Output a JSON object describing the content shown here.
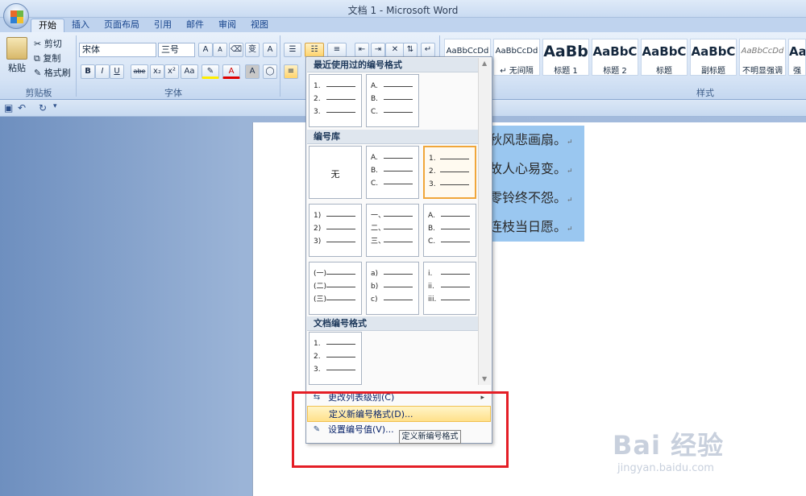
{
  "window": {
    "title": "文档 1 - Microsoft Word"
  },
  "tabs": [
    {
      "label": "开始",
      "active": true
    },
    {
      "label": "插入"
    },
    {
      "label": "页面布局"
    },
    {
      "label": "引用"
    },
    {
      "label": "邮件"
    },
    {
      "label": "审阅"
    },
    {
      "label": "视图"
    }
  ],
  "clipboard": {
    "paste": "粘贴",
    "cut": "剪切",
    "copy": "复制",
    "format_painter": "格式刷",
    "group": "剪贴板"
  },
  "font": {
    "family": "宋体",
    "size": "三号",
    "group": "字体",
    "bold": "B",
    "italic": "I",
    "underline": "U",
    "strike": "abe",
    "subscript": "x₂",
    "superscript": "x²",
    "case": "Aa",
    "color_a": "A",
    "grow": "A",
    "shrink": "A",
    "wen": "变",
    "box": "A"
  },
  "styles": {
    "group": "样式",
    "tiles": [
      {
        "sample": "AaBbCcDd",
        "name": ""
      },
      {
        "sample": "AaBbCcDd",
        "name": "↵ 无间隔"
      },
      {
        "sample": "AaBb",
        "name": "标题 1"
      },
      {
        "sample": "AaBbC",
        "name": "标题 2"
      },
      {
        "sample": "AaBbC",
        "name": "标题"
      },
      {
        "sample": "AaBbC",
        "name": "副标题"
      },
      {
        "sample": "AaBbCcDd",
        "name": "不明显强调"
      },
      {
        "sample": "AaBb",
        "name": "强"
      }
    ]
  },
  "document": {
    "lines": [
      "秋风悲画扇。",
      "故人心易变。",
      "零铃终不怨。",
      "连枝当日愿。"
    ],
    "return_mark": "↵"
  },
  "numbering_menu": {
    "recent_header": "最近使用过的编号格式",
    "library_header": "编号库",
    "doc_header": "文档编号格式",
    "none_label": "无",
    "recent": [
      [
        "1.",
        "2.",
        "3."
      ],
      [
        "A.",
        "B.",
        "C."
      ]
    ],
    "library": [
      [
        "A.",
        "B.",
        "C."
      ],
      [
        "1.",
        "2.",
        "3."
      ],
      [
        "1)",
        "2)",
        "3)"
      ],
      [
        "一、",
        "二、",
        "三、"
      ],
      [
        "A.",
        "B.",
        "C."
      ],
      [
        "(一)",
        "(二)",
        "(三)"
      ],
      [
        "a)",
        "b)",
        "c)"
      ],
      [
        "i.",
        "ii.",
        "iii."
      ]
    ],
    "document": [
      [
        "1.",
        "2.",
        "3."
      ]
    ],
    "items": {
      "change_level": "更改列表级别(C)",
      "define_new": "定义新编号格式(D)...",
      "set_value": "设置编号值(V)..."
    },
    "tooltip": "定义新编号格式"
  },
  "watermark": {
    "brand": "Bai 经验",
    "url": "jingyan.baidu.com"
  }
}
